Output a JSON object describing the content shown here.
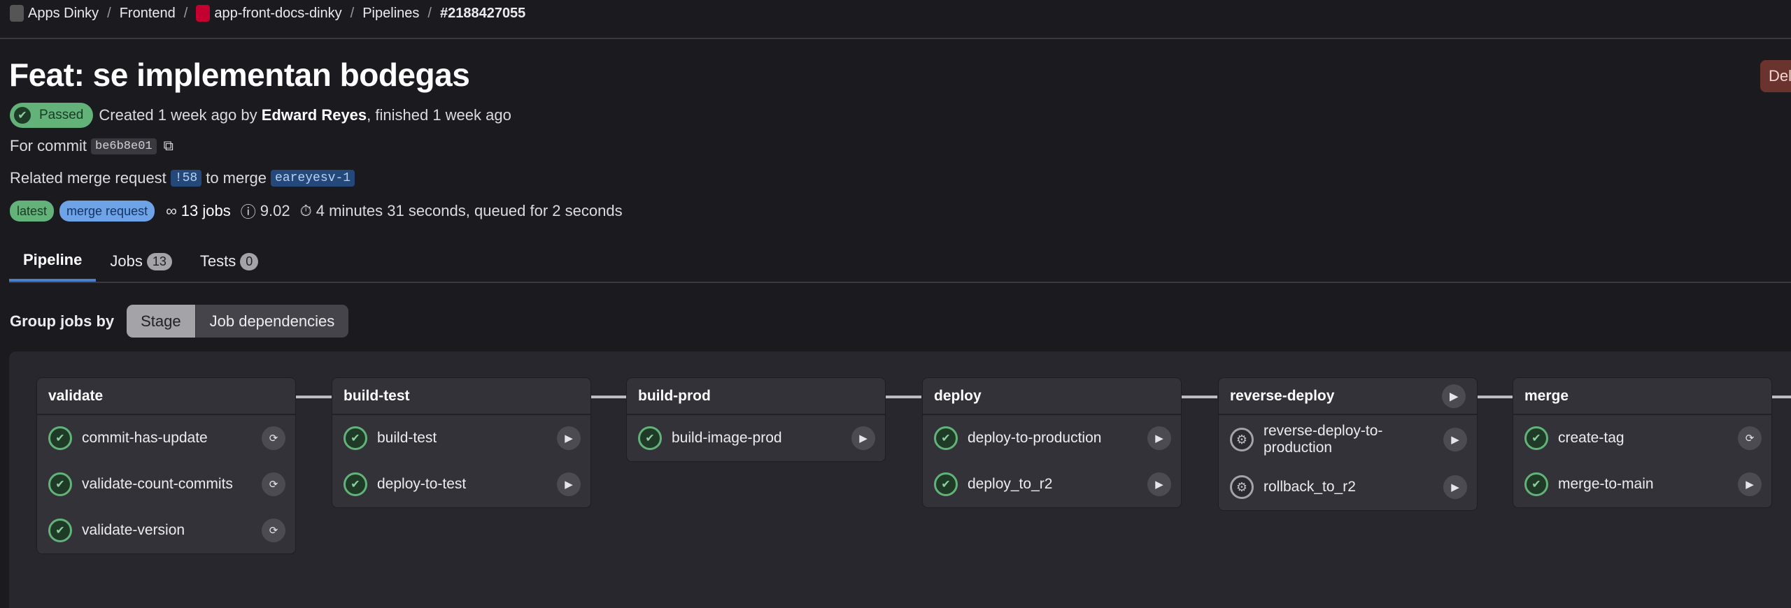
{
  "breadcrumb": [
    {
      "label": "Apps Dinky"
    },
    {
      "label": "Frontend"
    },
    {
      "label": "app-front-docs-dinky"
    },
    {
      "label": "Pipelines"
    },
    {
      "label": "#2188427055"
    }
  ],
  "title": "Feat: se implementan bodegas",
  "delete_label": "Delete",
  "status": {
    "label": "Passed",
    "color": "#62b27a"
  },
  "created": {
    "prefix": "Created 1 week ago by ",
    "author": "Edward Reyes",
    "suffix": ", finished 1 week ago"
  },
  "commit": {
    "label": "For commit",
    "sha": "be6b8e01",
    "copy_icon": "copy-icon"
  },
  "related": {
    "prefix": "Related merge request",
    "mr": "!58",
    "mid": "to merge",
    "branch": "eareyesv-1"
  },
  "badges": {
    "latest": "latest",
    "merge_request": "merge request",
    "jobs": "13 jobs",
    "compute": "9.02",
    "duration": "4 minutes 31 seconds, queued for 2 seconds"
  },
  "tabs": [
    {
      "label": "Pipeline"
    },
    {
      "label": "Jobs",
      "count": "13"
    },
    {
      "label": "Tests",
      "count": "0"
    }
  ],
  "group_by": {
    "label": "Group jobs by",
    "options": [
      "Stage",
      "Job dependencies"
    ],
    "selected": "Stage"
  },
  "stages": [
    {
      "name": "validate",
      "jobs": [
        {
          "name": "commit-has-update",
          "status": "passed",
          "action": "retry"
        },
        {
          "name": "validate-count-commits",
          "status": "passed",
          "action": "retry"
        },
        {
          "name": "validate-version",
          "status": "passed",
          "action": "retry"
        }
      ]
    },
    {
      "name": "build-test",
      "jobs": [
        {
          "name": "build-test",
          "status": "passed",
          "action": "play"
        },
        {
          "name": "deploy-to-test",
          "status": "passed",
          "action": "play"
        }
      ]
    },
    {
      "name": "build-prod",
      "jobs": [
        {
          "name": "build-image-prod",
          "status": "passed",
          "action": "play"
        }
      ]
    },
    {
      "name": "deploy",
      "jobs": [
        {
          "name": "deploy-to-production",
          "status": "passed",
          "action": "play"
        },
        {
          "name": "deploy_to_r2",
          "status": "passed",
          "action": "play"
        }
      ]
    },
    {
      "name": "reverse-deploy",
      "stage_action": "play",
      "jobs": [
        {
          "name": "reverse-deploy-to-production",
          "status": "manual",
          "action": "play"
        },
        {
          "name": "rollback_to_r2",
          "status": "manual",
          "action": "play"
        }
      ]
    },
    {
      "name": "merge",
      "jobs": [
        {
          "name": "create-tag",
          "status": "passed",
          "action": "retry"
        },
        {
          "name": "merge-to-main",
          "status": "passed",
          "action": "play"
        }
      ]
    }
  ]
}
